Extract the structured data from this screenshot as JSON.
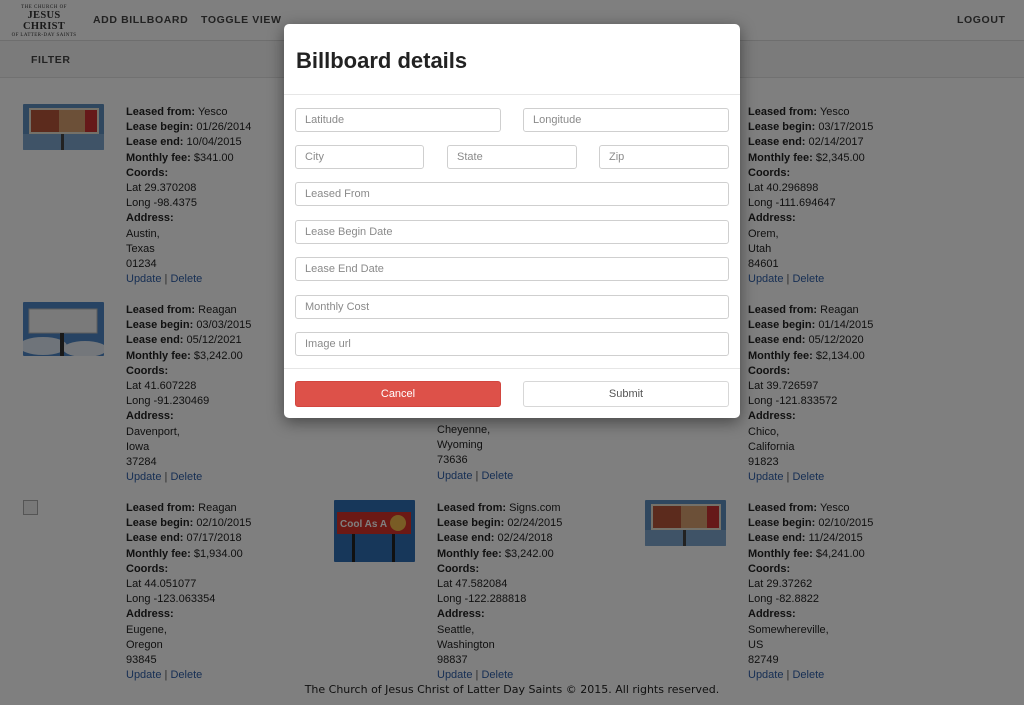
{
  "logo": {
    "line1": "THE CHURCH OF",
    "line2": "JESUS CHRIST",
    "line3": "OF LATTER-DAY SAINTS"
  },
  "nav": {
    "add_billboard": "ADD BILLBOARD",
    "toggle_view": "TOGGLE VIEW",
    "logout": "LOGOUT",
    "filter": "FILTER"
  },
  "labels": {
    "leased_from": "Leased from:",
    "lease_begin": "Lease begin:",
    "lease_end": "Lease end:",
    "monthly_fee": "Monthly fee:",
    "coords": "Coords:",
    "address": "Address:",
    "update": "Update",
    "delete": "Delete",
    "separator": "|"
  },
  "billboards": [
    {
      "leased_from": "Yesco",
      "lease_begin": "01/26/2014",
      "lease_end": "10/04/2015",
      "monthly_fee": "$341.00",
      "lat": "Lat 29.370208",
      "long": "Long -98.4375",
      "city": "Austin,",
      "state": "Texas",
      "zip": "01234",
      "image": "billboard-ad-photo"
    },
    {
      "leased_from": "Yesco",
      "lease_begin": "03/17/2015",
      "lease_end": "02/14/2017",
      "monthly_fee": "$2,345.00",
      "lat": "Lat 40.296898",
      "long": "Long -111.694647",
      "city": "Orem,",
      "state": "Utah",
      "zip": "84601",
      "image": "none"
    },
    {
      "leased_from": "Reagan",
      "lease_begin": "03/03/2015",
      "lease_end": "05/12/2021",
      "monthly_fee": "$3,242.00",
      "lat": "Lat 41.607228",
      "long": "Long -91.230469",
      "city": "Davenport,",
      "state": "Iowa",
      "zip": "37284",
      "image": "blank-billboard-photo"
    },
    {
      "city": "Cheyenne,",
      "state": "Wyoming",
      "zip": "73636"
    },
    {
      "leased_from": "Reagan",
      "lease_begin": "01/14/2015",
      "lease_end": "05/12/2020",
      "monthly_fee": "$2,134.00",
      "lat": "Lat 39.726597",
      "long": "Long -121.833572",
      "city": "Chico,",
      "state": "California",
      "zip": "91823",
      "image": "none"
    },
    {
      "leased_from": "Reagan",
      "lease_begin": "02/10/2015",
      "lease_end": "07/17/2018",
      "monthly_fee": "$1,934.00",
      "lat": "Lat 44.051077",
      "long": "Long -123.063354",
      "city": "Eugene,",
      "state": "Oregon",
      "zip": "93845",
      "image": "broken-image"
    },
    {
      "leased_from": "Signs.com",
      "lease_begin": "02/24/2015",
      "lease_end": "02/24/2018",
      "monthly_fee": "$3,242.00",
      "lat": "Lat 47.582084",
      "long": "Long -122.288818",
      "city": "Seattle,",
      "state": "Washington",
      "zip": "98837",
      "image": "cool-as-a-billboard-photo",
      "photo_text": "Cool As A"
    },
    {
      "leased_from": "Yesco",
      "lease_begin": "02/10/2015",
      "lease_end": "11/24/2015",
      "monthly_fee": "$4,241.00",
      "lat": "Lat 29.37262",
      "long": "Long -82.8822",
      "city": "Somewhereville,",
      "state": "US",
      "zip": "82749",
      "image": "billboard-ad-photo"
    }
  ],
  "footer": "The Church of Jesus Christ of Latter Day Saints © 2015. All rights reserved.",
  "modal": {
    "title": "Billboard details",
    "placeholders": {
      "latitude": "Latitude",
      "longitude": "Longitude",
      "city": "City",
      "state": "State",
      "zip": "Zip",
      "leased_from": "Leased From",
      "lease_begin": "Lease Begin Date",
      "lease_end": "Lease End Date",
      "monthly_cost": "Monthly Cost",
      "image_url": "Image url"
    },
    "cancel": "Cancel",
    "submit": "Submit"
  },
  "colors": {
    "cancel_bg": "#dd5149",
    "link": "#2e5fa8",
    "overlay": "rgba(0,0,0,0.5)"
  }
}
